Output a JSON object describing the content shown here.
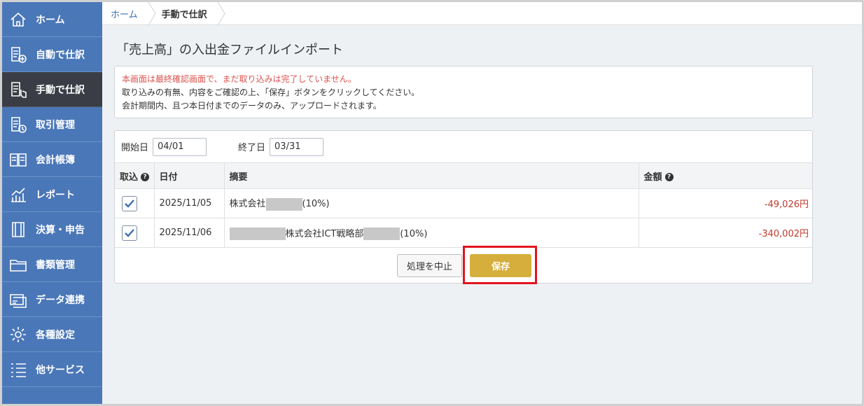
{
  "sidebar": {
    "items": [
      {
        "label": "ホーム",
        "icon": "home-icon",
        "active": false
      },
      {
        "label": "自動で仕訳",
        "icon": "auto-journal-icon",
        "active": false
      },
      {
        "label": "手動で仕訳",
        "icon": "manual-journal-icon",
        "active": true
      },
      {
        "label": "取引管理",
        "icon": "transaction-icon",
        "active": false
      },
      {
        "label": "会計帳簿",
        "icon": "ledger-icon",
        "active": false
      },
      {
        "label": "レポート",
        "icon": "report-icon",
        "active": false
      },
      {
        "label": "決算・申告",
        "icon": "settlement-icon",
        "active": false
      },
      {
        "label": "書類管理",
        "icon": "folder-icon",
        "active": false
      },
      {
        "label": "データ連携",
        "icon": "data-link-icon",
        "active": false
      },
      {
        "label": "各種設定",
        "icon": "gear-icon",
        "active": false
      },
      {
        "label": "他サービス",
        "icon": "list-icon",
        "active": false
      }
    ]
  },
  "breadcrumb": {
    "home": "ホーム",
    "current": "手動で仕訳"
  },
  "page_title": "「売上高」の入出金ファイルインポート",
  "notice": {
    "warning": "本画面は最終確認画面で、まだ取り込みは完了していません。",
    "line2": "取り込みの有無、内容をご確認の上、「保存」ボタンをクリックしてください。",
    "line3": "会計期間内、且つ本日付までのデータのみ、アップロードされます。"
  },
  "filters": {
    "start_label": "開始日",
    "start_value": "04/01",
    "end_label": "終了日",
    "end_value": "03/31"
  },
  "table": {
    "headers": {
      "import": "取込",
      "date": "日付",
      "description": "摘要",
      "amount": "金額"
    },
    "rows": [
      {
        "checked": true,
        "date": "2025/11/05",
        "desc_a": "株式会社",
        "desc_b": "(10%)",
        "amount": "-49,026円"
      },
      {
        "checked": true,
        "date": "2025/11/06",
        "desc_a": "株式会社ICT戦略部",
        "desc_b": "(10%)",
        "amount": "-340,002円"
      }
    ]
  },
  "buttons": {
    "cancel": "処理を中止",
    "save": "保存"
  },
  "colors": {
    "sidebar": "#4a77b8",
    "active": "#3a3d45",
    "save": "#d6ae3c",
    "highlight": "#e2141f",
    "negative": "#c0392b"
  }
}
